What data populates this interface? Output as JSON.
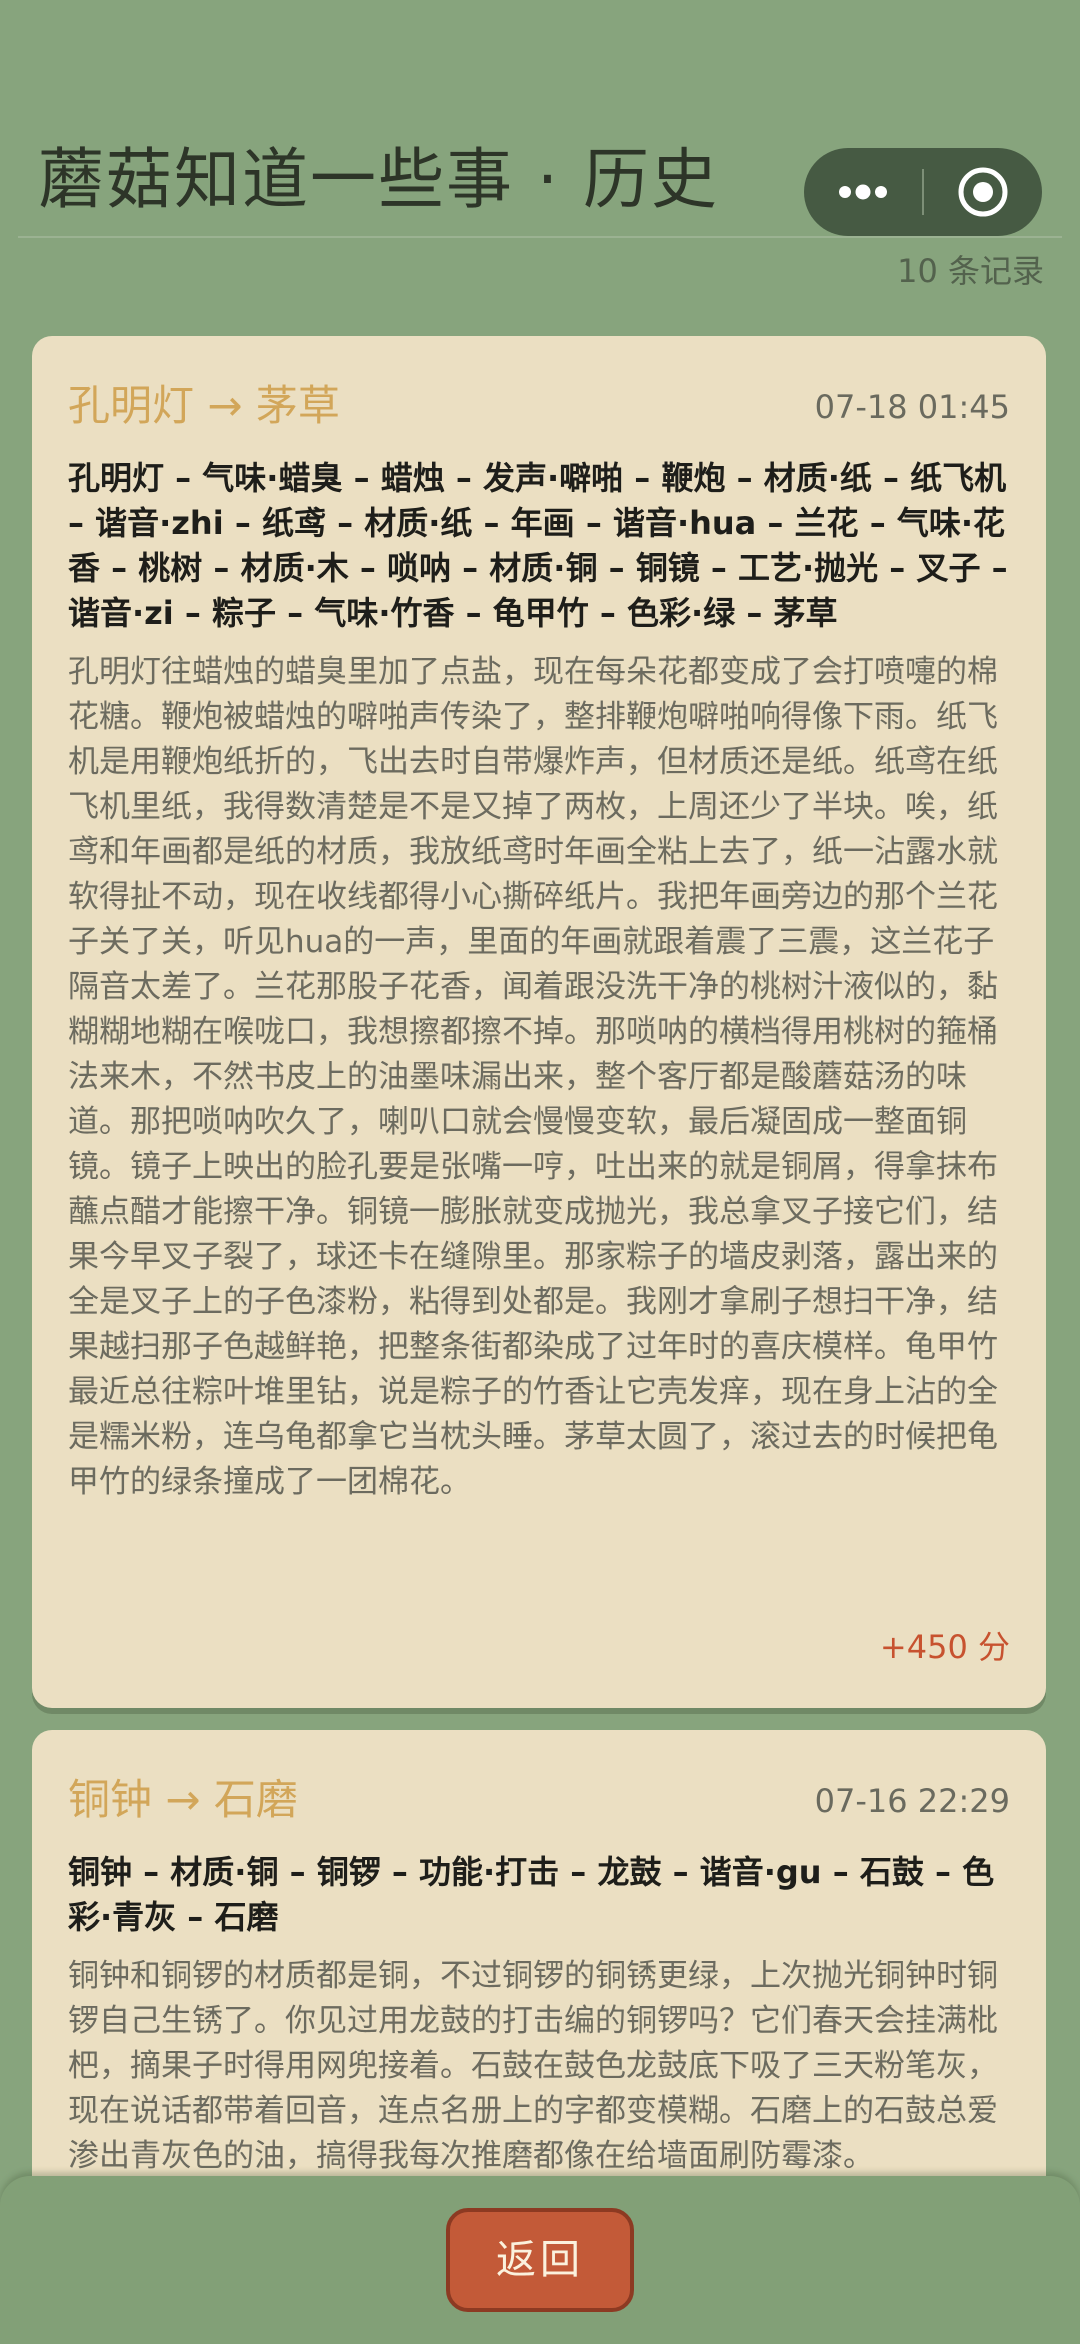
{
  "header": {
    "title": "蘑菇知道一些事 · 历史",
    "record_count": "10 条记录"
  },
  "records": [
    {
      "title": "孔明灯 → 茅草",
      "time": "07-18 01:45",
      "chain": "孔明灯 – 气味·蜡臭 – 蜡烛 – 发声·噼啪 – 鞭炮 – 材质·纸 – 纸飞机 – 谐音·zhi – 纸鸢 – 材质·纸 – 年画 – 谐音·hua – 兰花 – 气味·花香 – 桃树 – 材质·木 – 唢呐 – 材质·铜 – 铜镜 – 工艺·抛光 – 叉子 – 谐音·zi – 粽子 – 气味·竹香 – 龟甲竹 – 色彩·绿 – 茅草",
      "story": "孔明灯往蜡烛的蜡臭里加了点盐，现在每朵花都变成了会打喷嚏的棉花糖。鞭炮被蜡烛的噼啪声传染了，整排鞭炮噼啪响得像下雨。纸飞机是用鞭炮纸折的，飞出去时自带爆炸声，但材质还是纸。纸鸢在纸飞机里纸，我得数清楚是不是又掉了两枚，上周还少了半块。唉，纸鸢和年画都是纸的材质，我放纸鸢时年画全粘上去了，纸一沾露水就软得扯不动，现在收线都得小心撕碎纸片。我把年画旁边的那个兰花子关了关，听见hua的一声，里面的年画就跟着震了三震，这兰花子隔音太差了。兰花那股子花香，闻着跟没洗干净的桃树汁液似的，黏糊糊地糊在喉咙口，我想擦都擦不掉。那唢呐的横档得用桃树的箍桶法来木，不然书皮上的油墨味漏出来，整个客厅都是酸蘑菇汤的味道。那把唢呐吹久了，喇叭口就会慢慢变软，最后凝固成一整面铜镜。镜子上映出的脸孔要是张嘴一哼，吐出来的就是铜屑，得拿抹布蘸点醋才能擦干净。铜镜一膨胀就变成抛光，我总拿叉子接它们，结果今早叉子裂了，球还卡在缝隙里。那家粽子的墙皮剥落，露出来的全是叉子上的子色漆粉，粘得到处都是。我刚才拿刷子想扫干净，结果越扫那子色越鲜艳，把整条街都染成了过年时的喜庆模样。龟甲竹最近总往粽叶堆里钻，说是粽子的竹香让它壳发痒，现在身上沾的全是糯米粉，连乌龟都拿它当枕头睡。茅草太圆了，滚过去的时候把龟甲竹的绿条撞成了一团棉花。",
      "score": "+450 分"
    },
    {
      "title": "铜钟 → 石磨",
      "time": "07-16 22:29",
      "chain": "铜钟 – 材质·铜 – 铜锣 – 功能·打击 – 龙鼓 – 谐音·gu – 石鼓 – 色彩·青灰 – 石磨",
      "story": "铜钟和铜锣的材质都是铜，不过铜锣的铜锈更绿，上次抛光铜钟时铜锣自己生锈了。你见过用龙鼓的打击编的铜锣吗？它们春天会挂满枇杷，摘果子时得用网兜接着。石鼓在鼓色龙鼓底下吸了三天粉笔灰，现在说话都带着回音，连点名册上的字都变模糊。石磨上的石鼓总爱渗出青灰色的油，搞得我每次推磨都像在给墙面刷防霉漆。",
      "score": ""
    }
  ],
  "footer": {
    "back_label": "返回"
  },
  "colors": {
    "background": "#87a47d",
    "card": "#ebdfc2",
    "card_title": "#d2a659",
    "score": "#c7522f",
    "back_button": "#c35a38"
  },
  "icons": {
    "capsule_menu": "more-dots-icon",
    "capsule_close": "target-circle-icon"
  }
}
